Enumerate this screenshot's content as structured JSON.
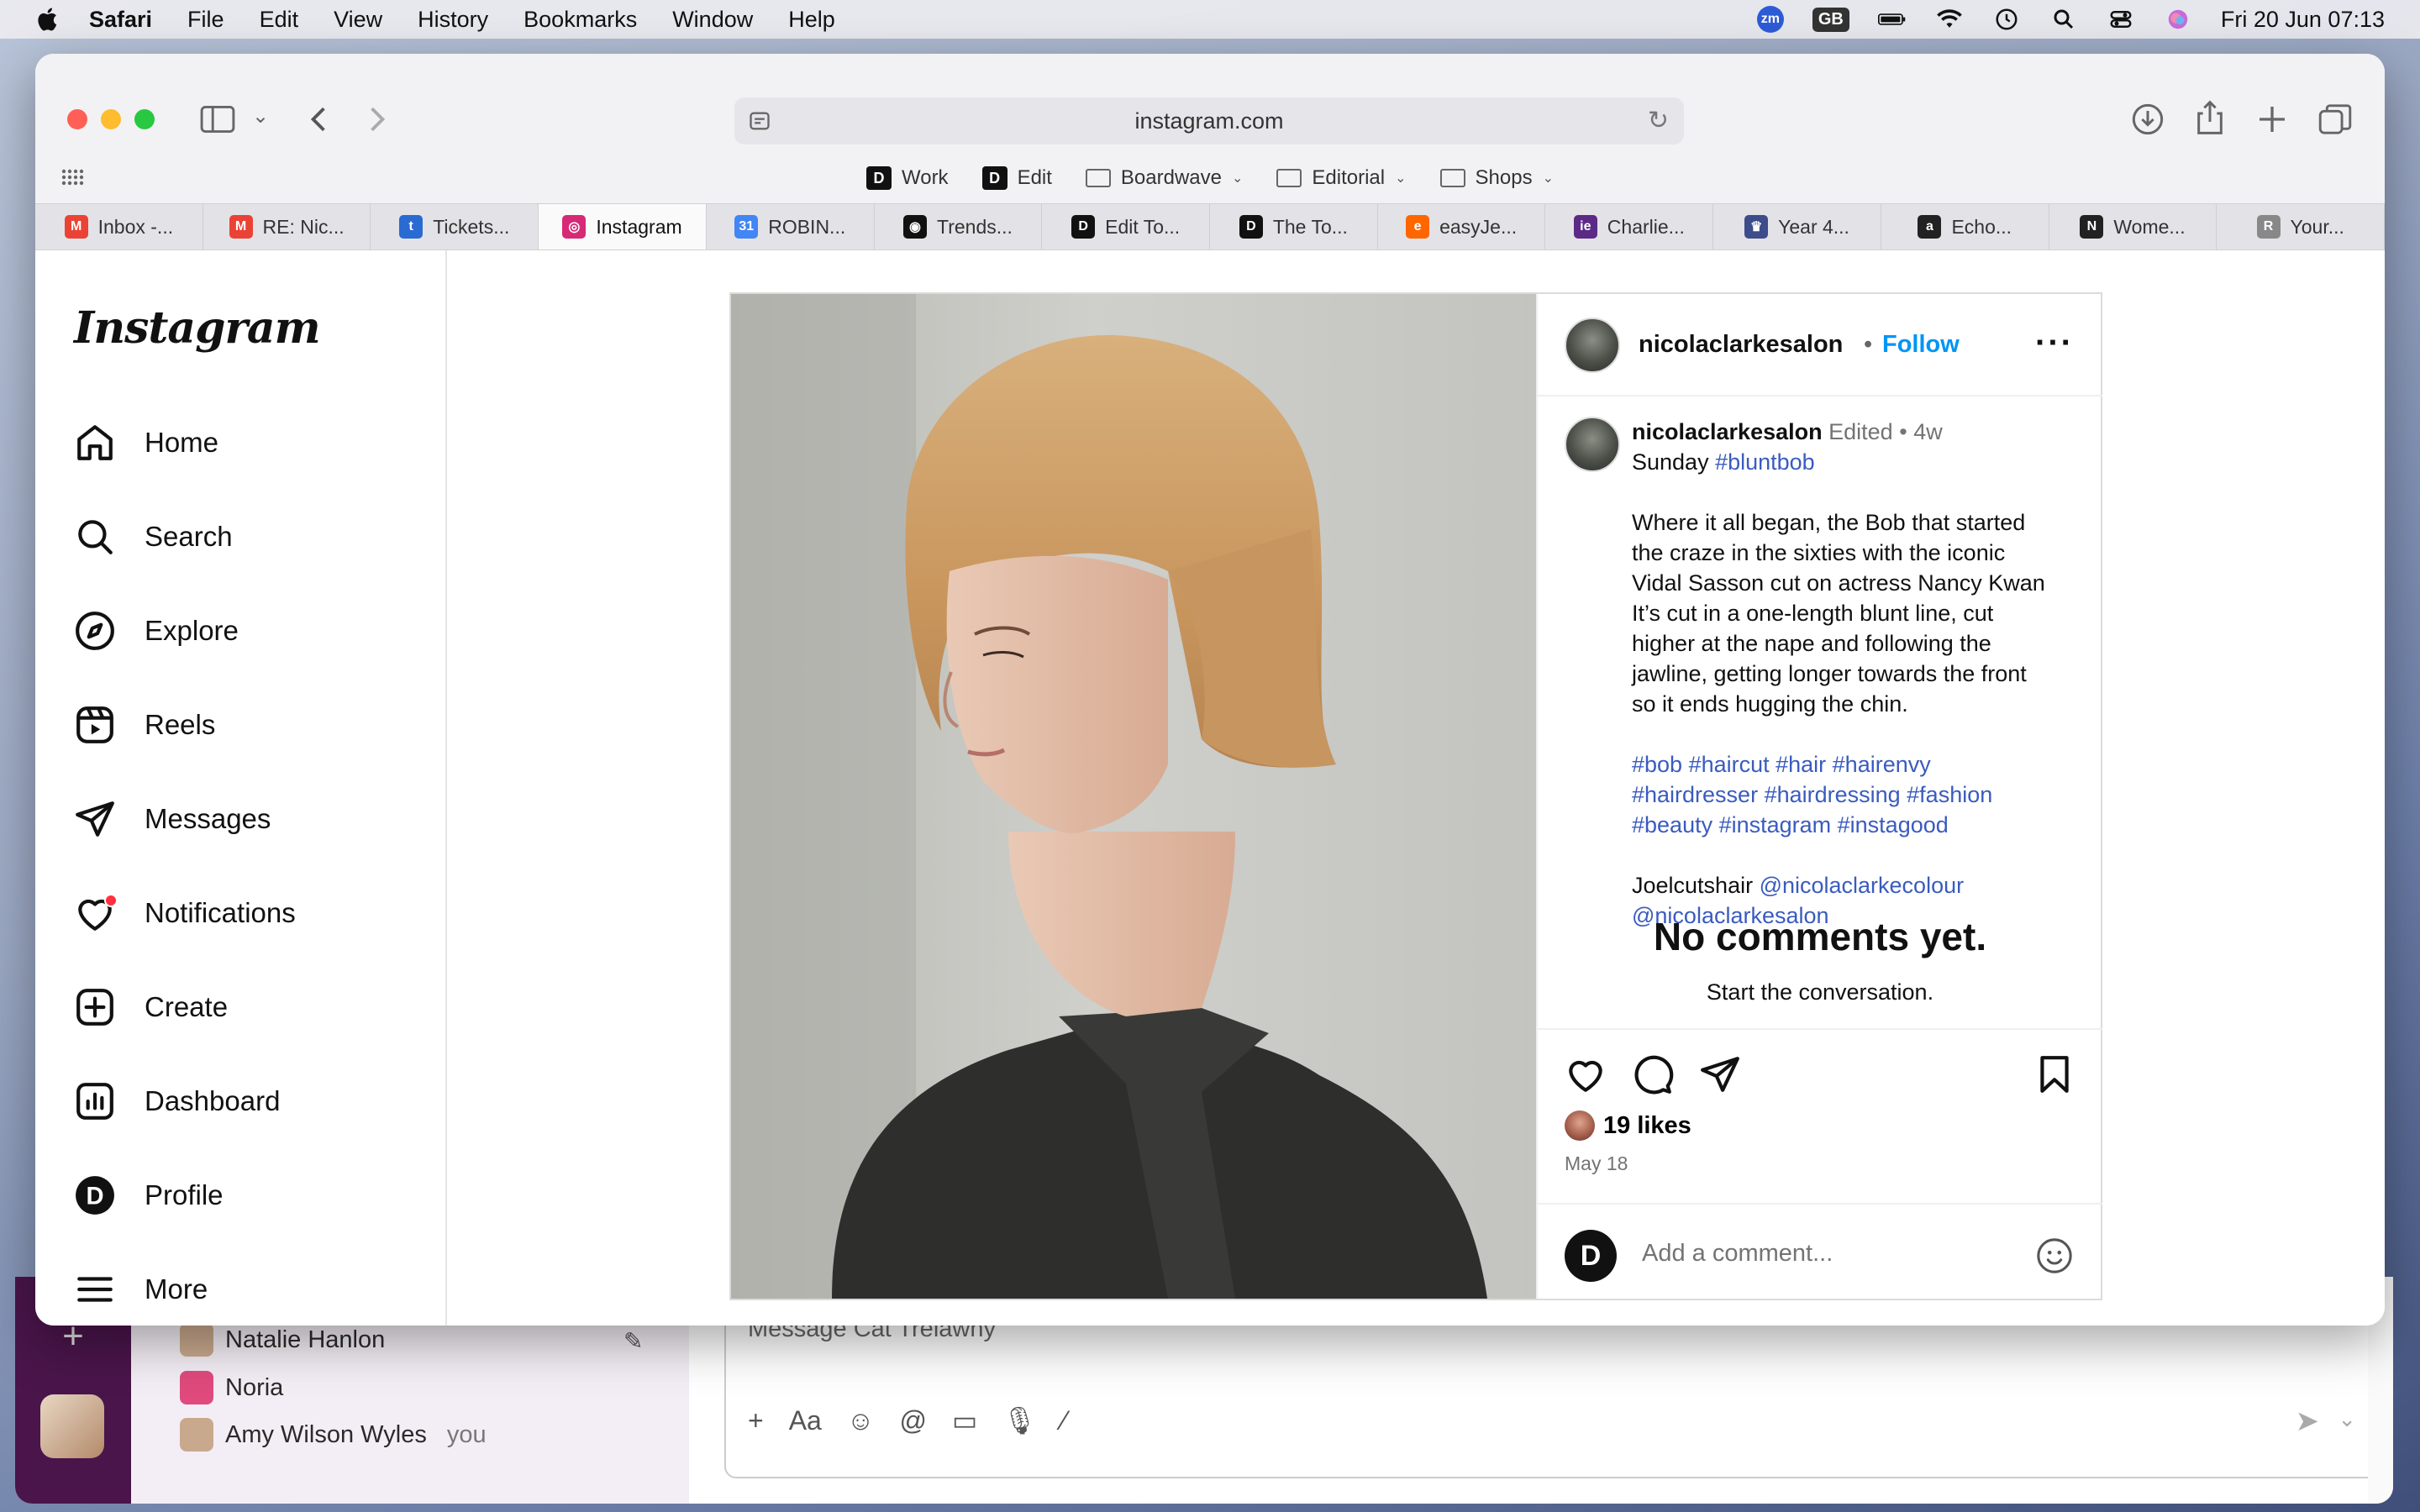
{
  "menubar": {
    "app": "Safari",
    "items": [
      "File",
      "Edit",
      "View",
      "History",
      "Bookmarks",
      "Window",
      "Help"
    ],
    "status": {
      "zoom_badge": "zm",
      "keyboard": "GB",
      "clock": "Fri 20 Jun  07:13"
    }
  },
  "safari": {
    "address": "instagram.com",
    "bookmarks": [
      {
        "label": "Work",
        "icon": "d-logo"
      },
      {
        "label": "Edit",
        "icon": "d-logo"
      },
      {
        "label": "Boardwave",
        "icon": "folder"
      },
      {
        "label": "Editorial",
        "icon": "folder"
      },
      {
        "label": "Shops",
        "icon": "folder"
      }
    ],
    "tabs": [
      {
        "label": "Inbox -...",
        "fav": "M",
        "color": "#ea4335"
      },
      {
        "label": "RE: Nic...",
        "fav": "M",
        "color": "#ea4335"
      },
      {
        "label": "Tickets...",
        "fav": "t",
        "color": "#2a6ad3"
      },
      {
        "label": "Instagram",
        "fav": "◎",
        "color": "#d62976",
        "active": true
      },
      {
        "label": "ROBIN...",
        "fav": "31",
        "color": "#4285f4"
      },
      {
        "label": "Trends...",
        "fav": "◉",
        "color": "#111111"
      },
      {
        "label": "Edit To...",
        "fav": "D",
        "color": "#111111"
      },
      {
        "label": "The To...",
        "fav": "D",
        "color": "#111111"
      },
      {
        "label": "easyJe...",
        "fav": "e",
        "color": "#ff6600"
      },
      {
        "label": "Charlie...",
        "fav": "ie",
        "color": "#5b2a86"
      },
      {
        "label": "Year 4...",
        "fav": "♛",
        "color": "#3d4c8a"
      },
      {
        "label": "Echo...",
        "fav": "a",
        "color": "#222222"
      },
      {
        "label": "Wome...",
        "fav": "N",
        "color": "#222222"
      },
      {
        "label": "Your...",
        "fav": "R",
        "color": "#888888"
      }
    ]
  },
  "instagram": {
    "logo": "Instagram",
    "nav": [
      {
        "label": "Home",
        "icon": "home-icon"
      },
      {
        "label": "Search",
        "icon": "search-icon"
      },
      {
        "label": "Explore",
        "icon": "compass-icon"
      },
      {
        "label": "Reels",
        "icon": "reels-icon"
      },
      {
        "label": "Messages",
        "icon": "paper-plane-icon"
      },
      {
        "label": "Notifications",
        "icon": "heart-icon"
      },
      {
        "label": "Create",
        "icon": "plus-square-icon"
      },
      {
        "label": "Dashboard",
        "icon": "chart-icon"
      },
      {
        "label": "Profile",
        "icon": "profile-avatar"
      },
      {
        "label": "More",
        "icon": "hamburger-icon"
      }
    ],
    "post": {
      "username": "nicolaclarkesalon",
      "dot": "•",
      "follow": "Follow",
      "caption": {
        "username": "nicolaclarkesalon",
        "edited": "Edited",
        "dot": "•",
        "age": "4w",
        "line1_text": "Sunday ",
        "line1_tag": "#bluntbob",
        "body": [
          "Where it all began, the Bob that started",
          "the craze in the sixties with the iconic",
          "Vidal Sasson cut on actress Nancy Kwan",
          "It’s cut in a one-length blunt line, cut",
          "higher at the nape and following the",
          "jawline, getting longer towards the front",
          "so it ends hugging the chin."
        ],
        "hashtags": [
          "#bob #haircut #hair #hairenvy",
          "#hairdresser #hairdressing #fashion",
          "#beauty #instagram #instagood"
        ],
        "credit_text": "Joelcutshair ",
        "credit_mentions": [
          "@nicolaclarkecolour",
          "@nicolaclarkesalon"
        ]
      },
      "no_comments": "No comments yet.",
      "start_conversation": "Start the conversation.",
      "likes": "19 likes",
      "date": "May 18",
      "comment_placeholder": "Add a comment..."
    }
  },
  "background_app": {
    "dms": [
      {
        "name": "Natalie Hanlon"
      },
      {
        "name": "Noria"
      },
      {
        "name": "Amy Wilson Wyles",
        "suffix": "you"
      }
    ],
    "composer_placeholder": "Message Cat Trelawny",
    "tools": [
      "+",
      "Aa",
      "☺",
      "@",
      "▭",
      "🎙",
      "⁄"
    ]
  }
}
